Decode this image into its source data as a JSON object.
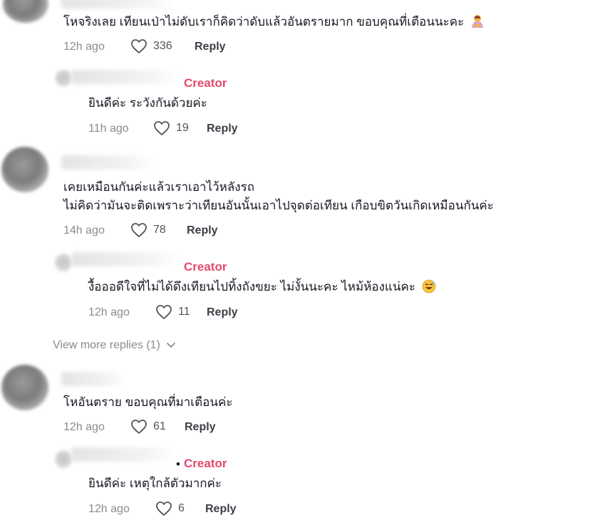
{
  "comments": [
    {
      "text": "โหจริงเลย เทียนเป่าไม่ดับเราก็คิดว่าดับแล้วอันตรายมาก ขอบคุณที่เตือนนะคะ",
      "emoji": "person-bowing-emoji",
      "time": "12h ago",
      "likes": "336",
      "reply": "Reply"
    },
    {
      "creator_badge": "Creator",
      "text": "ยินดีค่ะ ระวังกันด้วยค่ะ",
      "time": "11h ago",
      "likes": "19",
      "reply": "Reply"
    },
    {
      "text_line1": "เคยเหมือนกันค่ะแล้วเราเอาไว้หลังรถ",
      "text_line2": "ไม่คิดว่ามันจะติดเพราะว่าเทียนอันนั้นเอาไปจุดต่อเทียน เกือบขิตวันเกิดเหมือนกันค่ะ",
      "time": "14h ago",
      "likes": "78",
      "reply": "Reply"
    },
    {
      "creator_badge": "Creator",
      "text": "งื้อออดีใจที่ไม่ได้ดึงเทียนไปทิ้งถังขยะ ไม่งั้นนะคะ ไหม้ห้องแน่คะ",
      "emoji": "sweat-smile-emoji",
      "time": "12h ago",
      "likes": "11",
      "reply": "Reply"
    },
    {
      "text": "โหอันตราย ขอบคุณที่มาเตือนค่ะ",
      "time": "12h ago",
      "likes": "61",
      "reply": "Reply"
    },
    {
      "creator_badge": "Creator",
      "text": "ยินดีค่ะ เหตุใกล้ตัวมากค่ะ",
      "time": "12h ago",
      "likes": "6",
      "reply": "Reply"
    }
  ],
  "view_more_replies": "View more replies (1)",
  "colors": {
    "creator": "#e5496d",
    "meta": "#8a8b91",
    "text": "#161823"
  }
}
